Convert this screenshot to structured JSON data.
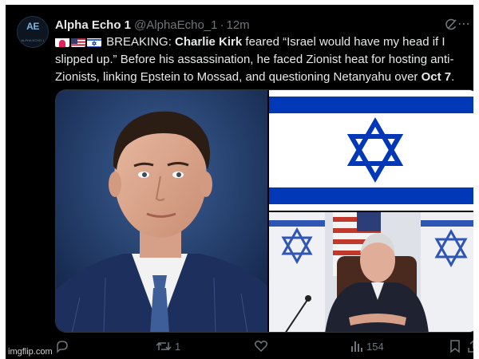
{
  "tweet": {
    "author_name": "Alpha Echo 1",
    "handle": "@AlphaEcho_1",
    "separator": "·",
    "time": "12m",
    "avatar_text": "AE",
    "avatar_subtext": "ALPHA ECHO 1",
    "text": {
      "label": "BREAKING:",
      "name": "Charlie Kirk",
      "part1": "feared “Israel would have my head if I slipped up.” Before his assassination, he faced Zionist heat for hosting anti-Zionists, linking Epstein to Mossad, and questioning Netanyahu over",
      "date": "Oct 7",
      "end": "."
    },
    "emojis": [
      "emergency-light-icon",
      "us-flag-icon",
      "israel-flag-icon"
    ]
  },
  "actions": {
    "replies": "",
    "retweets": "1",
    "likes": "",
    "views": "154"
  },
  "watermark": "imgflip.com",
  "colors": {
    "background": "#000000",
    "text": "#e7e9ea",
    "muted": "#71767b",
    "flag_blue": "#0038b8"
  }
}
